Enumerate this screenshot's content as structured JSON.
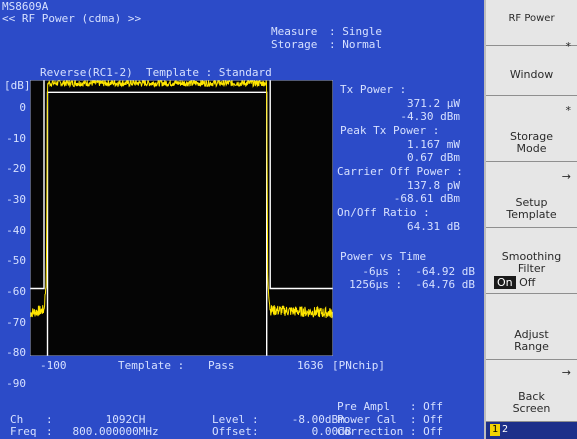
{
  "header": {
    "model": "MS8609A",
    "mode": "<< RF Power (cdma) >>",
    "measure_label": "Measure",
    "measure_value": ": Single",
    "storage_label": "Storage",
    "storage_value": ": Normal"
  },
  "graph": {
    "unit_label": "[dB]",
    "title": "Reverse(RC1-2)  Template : Standard",
    "y_ticks": [
      "0",
      "-10",
      "-20",
      "-30",
      "-40",
      "-50",
      "-60",
      "-70",
      "-80",
      "-90"
    ],
    "x_start": "-100",
    "x_end": "1636",
    "x_unit": "[PNchip]",
    "template_label": "Template :",
    "template_result": "Pass"
  },
  "chart_data": {
    "type": "line",
    "title": "Reverse(RC1-2)  Template : Standard",
    "xlabel": "[PNchip]",
    "ylabel": "[dB]",
    "xlim": [
      -100,
      1636
    ],
    "ylim": [
      -90,
      0
    ],
    "series": [
      {
        "x": [
          -100,
          -20,
          -6,
          0,
          1256,
          1262,
          1276,
          1636
        ],
        "y": [
          -76,
          -75,
          -64.92,
          -1,
          -1,
          -64.76,
          -75,
          -76
        ]
      }
    ],
    "template_upper": {
      "x": [
        -100,
        -20,
        -20,
        1276,
        1276,
        1636
      ],
      "y": [
        -68,
        -68,
        2,
        2,
        -68,
        -68
      ]
    },
    "template_lower": {
      "x": [
        0,
        0,
        1256,
        1256
      ],
      "y": [
        -90,
        -4,
        -4,
        -90
      ]
    }
  },
  "results": {
    "tx_power_label": "Tx Power :",
    "tx_power_w": "371.2 μW",
    "tx_power_dbm": "-4.30 dBm",
    "peak_label": "Peak Tx Power :",
    "peak_w": "1.167 mW",
    "peak_dbm": "0.67 dBm",
    "carrier_off_label": "Carrier Off Power :",
    "carrier_off_w": "137.8 pW",
    "carrier_off_dbm": "-68.61 dBm",
    "ratio_label": "On/Off Ratio :",
    "ratio_value": "64.31 dB",
    "pvt_label": "Power vs Time",
    "pvt_row1": "-6μs :  -64.92 dB",
    "pvt_row2": "1256μs :  -64.76 dB"
  },
  "footer": {
    "ch_label": "Ch",
    "ch_value": ":        1092CH",
    "freq_label": "Freq",
    "freq_value": ":   800.000000MHz",
    "level_label": "Level",
    "level_value": ":     -8.00dBm",
    "offset_label": "Offset",
    "offset_value": ":        0.00dB",
    "preampl": "Pre Ampl   : Off",
    "powercal": "Power Cal  : Off",
    "correction": "Correction : Off"
  },
  "softkeys": {
    "title": "RF Power",
    "window": "Window",
    "storage_mode": "Storage\nMode",
    "setup_template": "Setup\nTemplate",
    "smoothing": "Smoothing\nFilter",
    "smoothing_on": "On",
    "smoothing_off": "Off",
    "adjust_range": "Adjust\nRange",
    "back_screen": "Back\nScreen",
    "page_1": "1",
    "page_2": "2",
    "star": "*",
    "arrow": "→"
  },
  "colors": {
    "background": "#2c4bc8",
    "plot_bg": "#050505",
    "trace": "#ffe600",
    "template": "#ffffff",
    "softkey_bg": "#e6e6e6"
  }
}
